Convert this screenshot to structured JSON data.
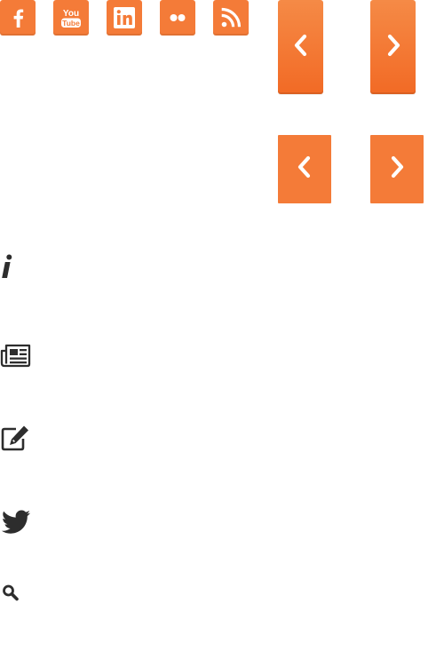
{
  "colors": {
    "social_bg": "#f47b38",
    "arrow_big_top": "#f58a46",
    "arrow_big_bottom": "#f26a25",
    "arrow_small": "#f47b38",
    "arrow_glyph": "#ffffff",
    "dark_icon": "#2d2d2d"
  },
  "social_icons": [
    {
      "name": "facebook-icon",
      "label": "f"
    },
    {
      "name": "youtube-icon",
      "label_top": "You",
      "label_bottom": "Tube"
    },
    {
      "name": "linkedin-icon",
      "label": "in"
    },
    {
      "name": "flickr-icon",
      "label": ""
    },
    {
      "name": "rss-icon",
      "label": ""
    }
  ],
  "arrows": {
    "big_prev": "prev-arrow-icon",
    "big_next": "next-arrow-icon",
    "small_prev": "prev-arrow-icon",
    "small_next": "next-arrow-icon"
  },
  "glyph_icons": [
    "info-icon",
    "newspaper-icon",
    "edit-icon",
    "twitter-icon",
    "search-icon"
  ]
}
